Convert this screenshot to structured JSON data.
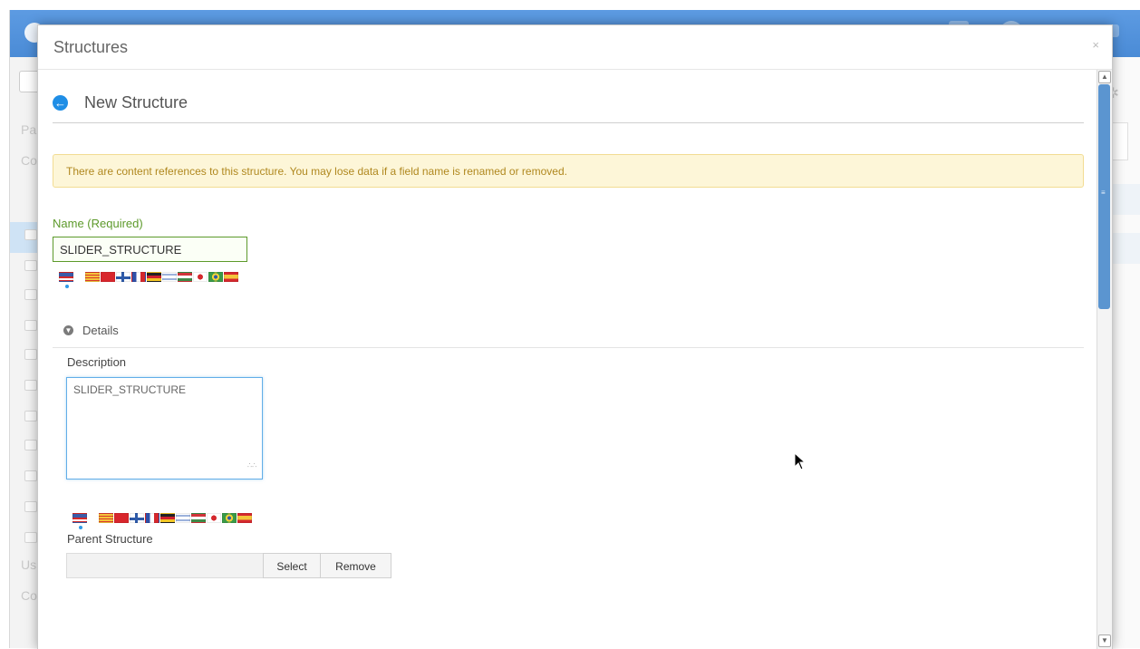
{
  "modal": {
    "title": "Structures",
    "close_glyph": "×",
    "subtitle": "New Structure",
    "back_icon": "arrow-left-circle-icon"
  },
  "alert": {
    "text": "There are content references to this structure. You may lose data if a field name is renamed or removed.",
    "color": "#b0881f",
    "background": "#fdf6d8"
  },
  "name_field": {
    "label": "Name (Required)",
    "value": "SLIDER_STRUCTURE",
    "accent_color": "#5d9a2b"
  },
  "details": {
    "label": "Details",
    "icon": "chevron-down-circle-icon"
  },
  "description": {
    "label": "Description",
    "value": "SLIDER_STRUCTURE"
  },
  "parent_structure": {
    "label": "Parent Structure",
    "value": "",
    "select_label": "Select",
    "remove_label": "Remove"
  },
  "language_flags": [
    "en-US",
    "ca-ES",
    "zh-CN",
    "fi-FI",
    "fr-FR",
    "de-DE",
    "iw-IL",
    "hu-HU",
    "ja-JP",
    "pt-BR",
    "es-ES"
  ],
  "selected_language": "en-US",
  "background_app": {
    "sidebar_letters": [
      "Pa",
      "Co",
      "Us",
      "Co"
    ]
  },
  "colors": {
    "accent_blue": "#1f8ee6",
    "header_blue": "#4a8bd6",
    "scroll_thumb": "#5b95d0"
  }
}
